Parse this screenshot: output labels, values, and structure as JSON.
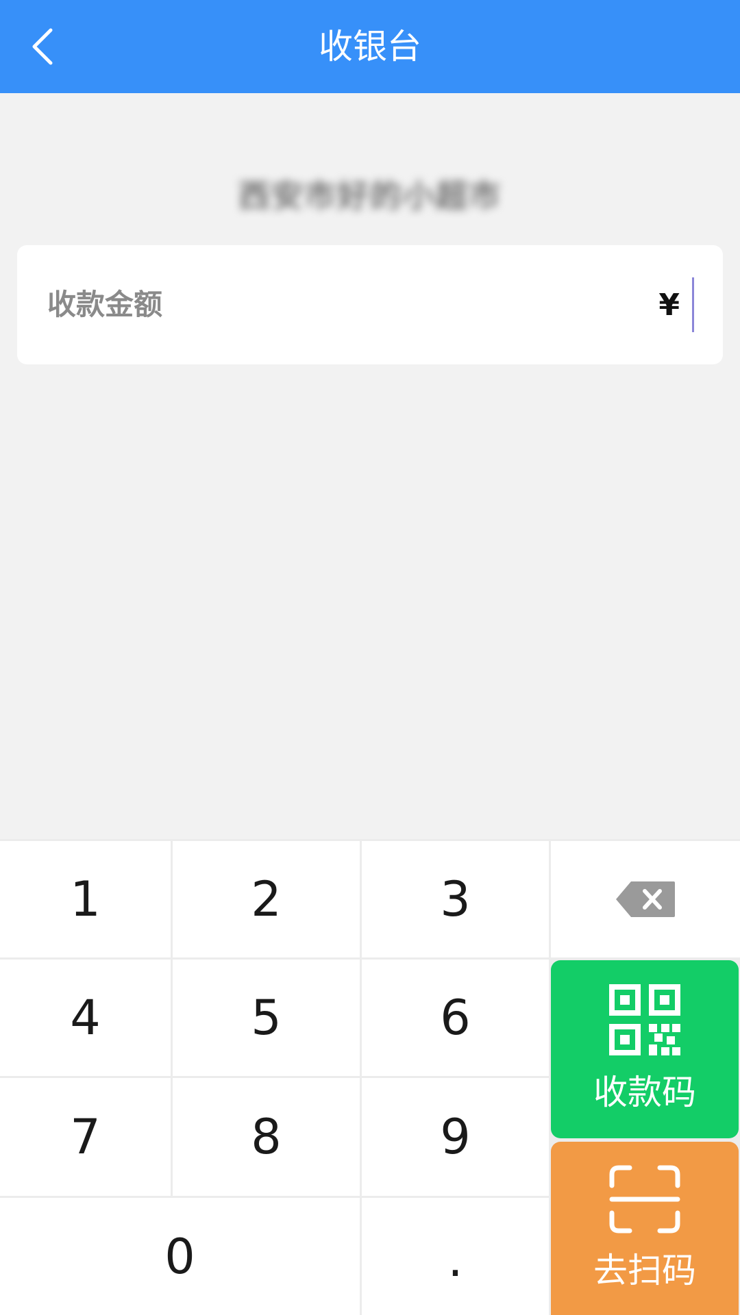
{
  "header": {
    "title": "收银台"
  },
  "merchant": {
    "name": "西安市好的小超市"
  },
  "amount": {
    "label": "收款金额",
    "currency_symbol": "¥",
    "value": ""
  },
  "keypad": {
    "keys": [
      "1",
      "2",
      "3",
      "4",
      "5",
      "6",
      "7",
      "8",
      "9",
      "0",
      "."
    ]
  },
  "actions": {
    "receive_code_label": "收款码",
    "scan_label": "去扫码"
  },
  "colors": {
    "header_bg": "#3790f9",
    "receive_code_bg": "#13cd67",
    "scan_bg": "#f29a45"
  },
  "icons": {
    "back": "chevron-left-icon",
    "backspace": "backspace-icon",
    "qr": "qr-code-icon",
    "scan": "scan-frame-icon"
  }
}
